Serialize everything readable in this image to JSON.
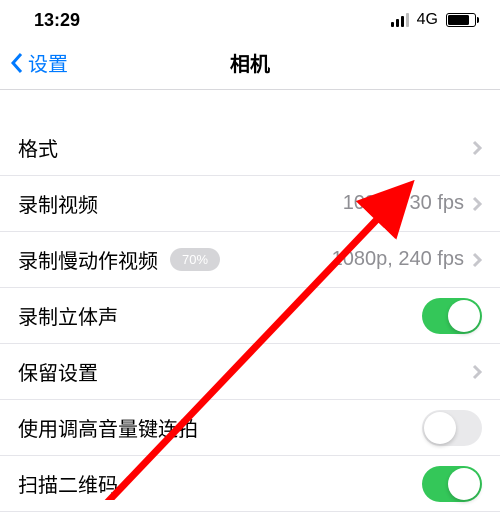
{
  "statusBar": {
    "time": "13:29",
    "network": "4G"
  },
  "nav": {
    "back": "设置",
    "title": "相机"
  },
  "rows": {
    "format": {
      "label": "格式"
    },
    "recordVideo": {
      "label": "录制视频",
      "value": "1080p, 30 fps"
    },
    "recordSlomo": {
      "label": "录制慢动作视频",
      "value": "1080p, 240 fps",
      "badge": "70%"
    },
    "stereo": {
      "label": "录制立体声",
      "on": true
    },
    "preserve": {
      "label": "保留设置"
    },
    "volumeBurst": {
      "label": "使用调高音量键连拍",
      "on": false
    },
    "scanQR": {
      "label": "扫描二维码",
      "on": true
    }
  }
}
